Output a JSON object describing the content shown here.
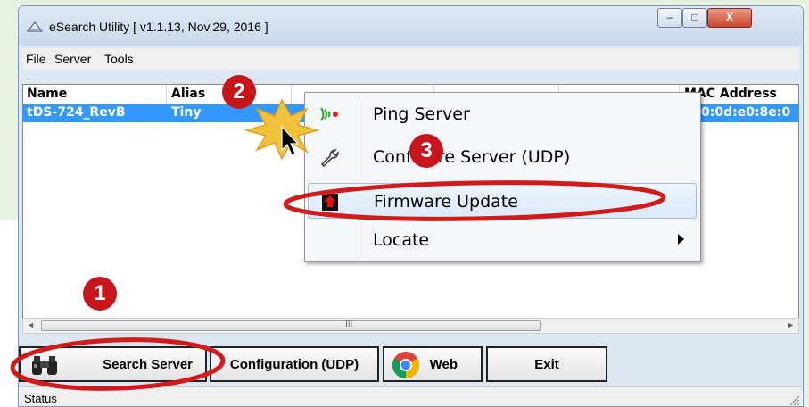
{
  "window": {
    "title": "eSearch Utility [ v1.1.13, Nov.29, 2016 ]",
    "controls": {
      "minimize": "–",
      "maximize": "□",
      "close": "X"
    }
  },
  "menubar": {
    "items": [
      "File",
      "Server",
      "Tools"
    ]
  },
  "table": {
    "columns": [
      "Name",
      "Alias",
      "",
      "",
      "",
      "MAC Address"
    ],
    "selected_row": {
      "name": "tDS-724_RevB",
      "alias": "Tiny",
      "mac": "0:0d:e0:8e:0"
    }
  },
  "hscroll": {
    "left_arrow": "◄",
    "right_arrow": "►",
    "grip": "III"
  },
  "buttons": {
    "search": "Search Server",
    "config": "Configuration (UDP)",
    "web": "Web",
    "exit": "Exit"
  },
  "status": {
    "text": "Status"
  },
  "context_menu": {
    "items": [
      {
        "label": "Ping Server",
        "icon": "signal-icon"
      },
      {
        "label": "Configure Server (UDP)",
        "icon": "wrench-icon"
      },
      {
        "label": "Firmware Update",
        "icon": "upload-icon"
      },
      {
        "label": "Locate",
        "icon": ""
      }
    ]
  },
  "annotations": {
    "step1": "1",
    "step2": "2",
    "step3": "3"
  },
  "colors": {
    "selection": "#3399ff",
    "highlight_ring": "#c8151b",
    "badge": "#c8151b"
  }
}
